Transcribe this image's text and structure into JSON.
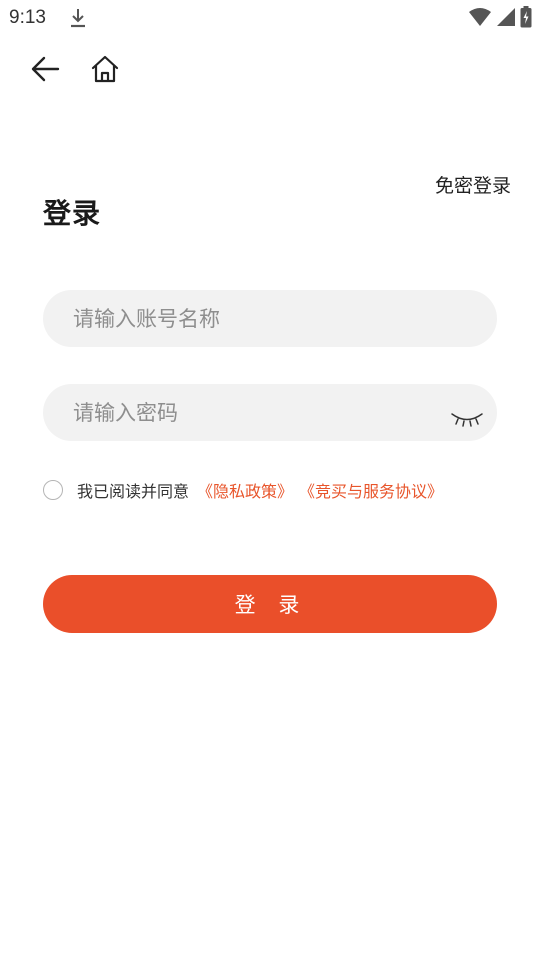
{
  "status_bar": {
    "time": "9:13",
    "icons": [
      "download-icon",
      "wifi-icon",
      "cellular-signal-icon",
      "battery-charging-icon"
    ]
  },
  "nav": {
    "back_icon": "arrow-left-icon",
    "home_icon": "home-icon"
  },
  "header": {
    "title": "登录",
    "alt_login_label": "免密登录"
  },
  "form": {
    "username_placeholder": "请输入账号名称",
    "username_value": "",
    "password_placeholder": "请输入密码",
    "password_value": "",
    "password_toggle_icon": "eye-closed-icon"
  },
  "agreement": {
    "checked": false,
    "text": "我已阅读并同意",
    "privacy_link": "《隐私政策》",
    "service_link": "《竞买与服务协议》"
  },
  "actions": {
    "login_label": "登 录"
  },
  "colors": {
    "accent": "#ea4f2a",
    "link": "#e8552b",
    "field_bg": "#f2f2f2",
    "background": "#ffffff"
  }
}
